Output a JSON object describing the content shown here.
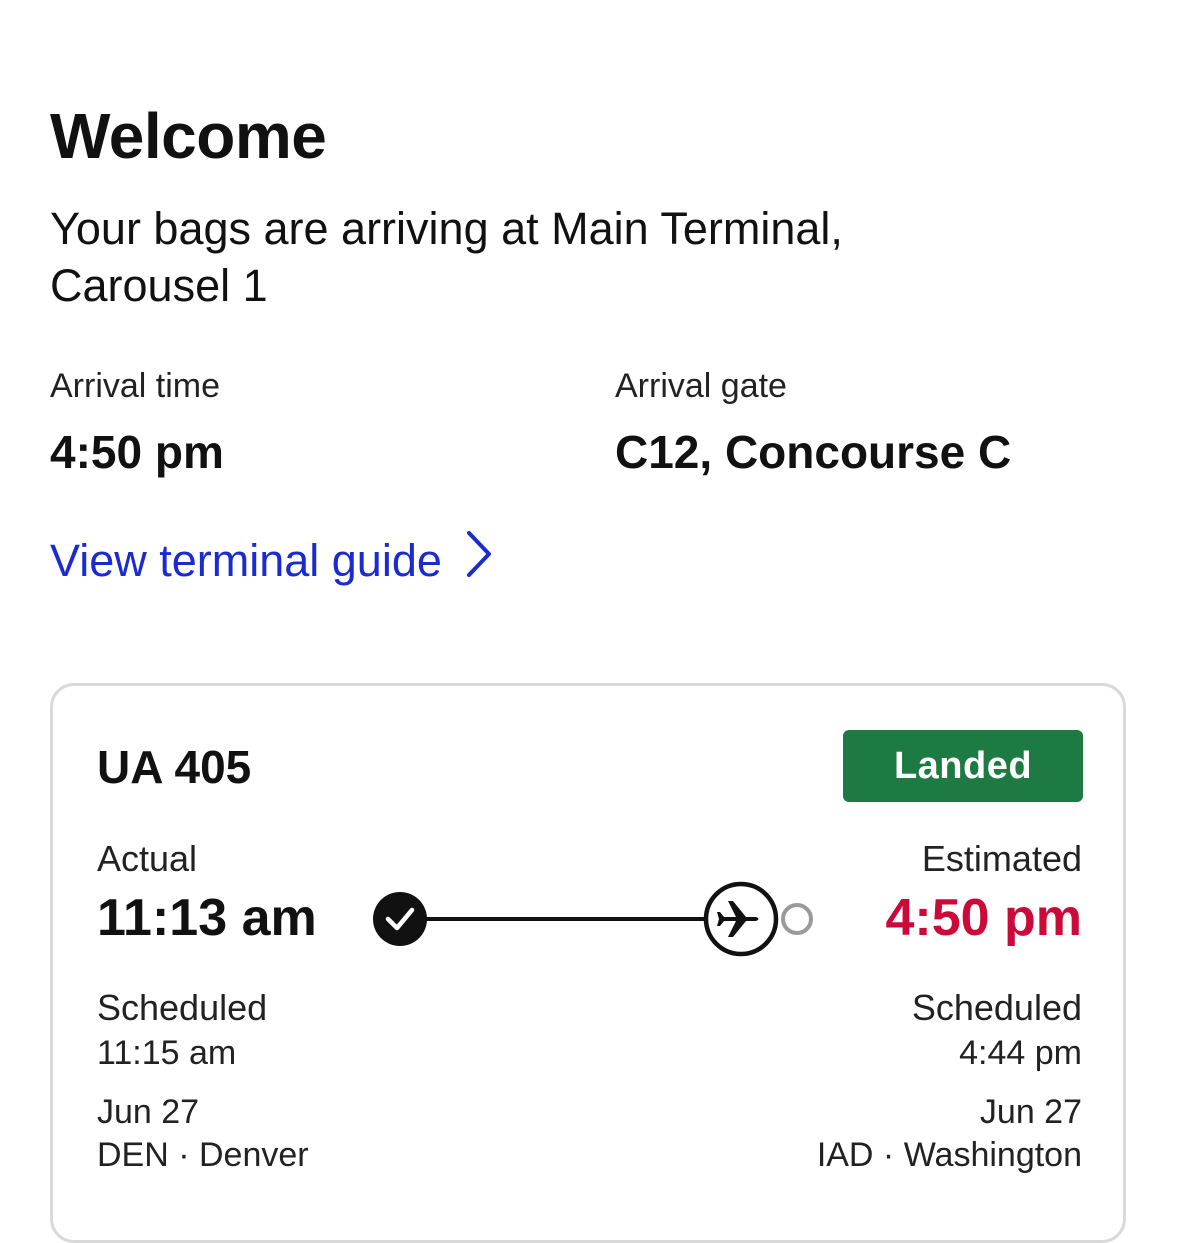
{
  "header": {
    "title": "Welcome",
    "bags_message": "Your bags are arriving at Main Terminal, Carousel 1"
  },
  "arrival": {
    "time_label": "Arrival time",
    "time_value": "4:50 pm",
    "gate_label": "Arrival gate",
    "gate_value": "C12, Concourse C"
  },
  "terminal_guide_link": "View terminal guide",
  "flight": {
    "number": "UA 405",
    "status": "Landed",
    "status_color": "#1d7a43",
    "departure": {
      "status_label": "Actual",
      "time": "11:13 am",
      "scheduled_label": "Scheduled",
      "scheduled_time": "11:15 am",
      "date": "Jun 27",
      "airport": "DEN · Denver"
    },
    "arrival": {
      "status_label": "Estimated",
      "time": "4:50 pm",
      "time_color": "#cc0a3a",
      "scheduled_label": "Scheduled",
      "scheduled_time": "4:44 pm",
      "date": "Jun 27",
      "airport": "IAD · Washington"
    },
    "progress_icons": [
      "check-icon",
      "airplane-icon",
      "destination-dot-icon"
    ]
  },
  "colors": {
    "link": "#1b2bd0",
    "accent_red": "#cc0a3a",
    "landed_green": "#1d7a43"
  }
}
